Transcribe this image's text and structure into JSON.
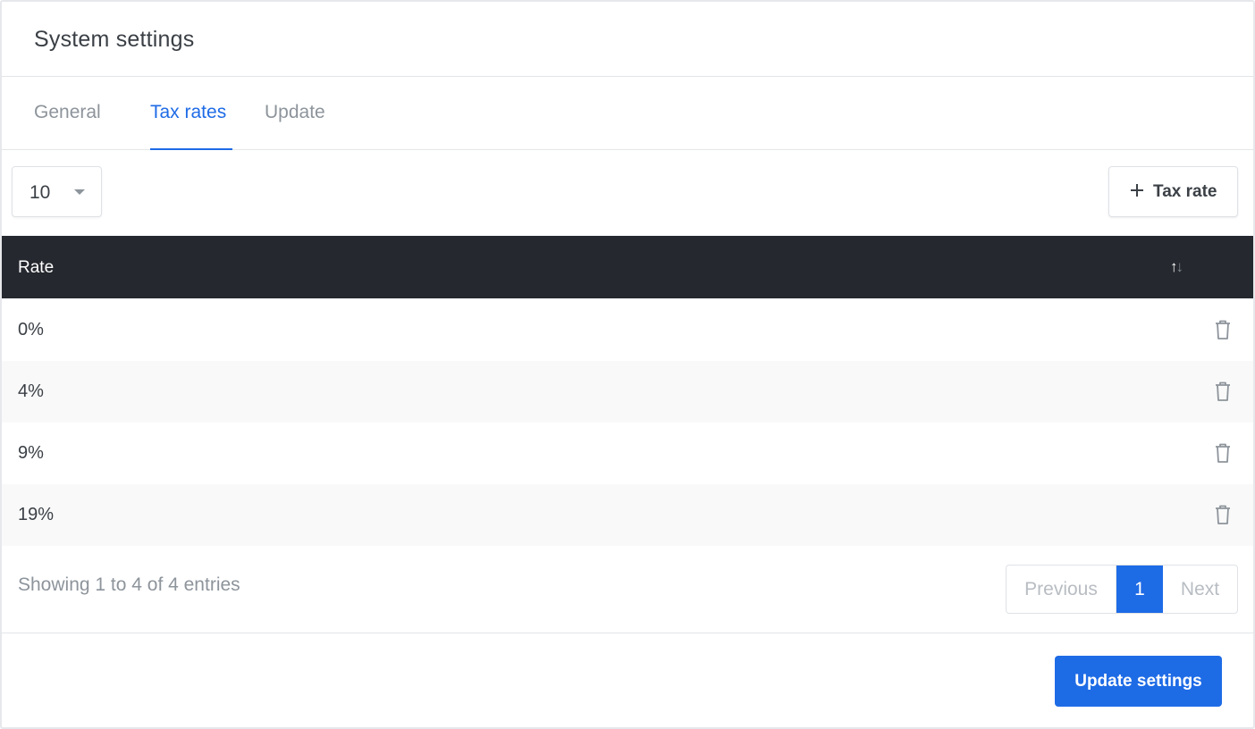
{
  "card": {
    "title": "System settings"
  },
  "tabs": [
    {
      "label": "General",
      "active": false
    },
    {
      "label": "Tax rates",
      "active": true
    },
    {
      "label": "Update",
      "active": false
    }
  ],
  "toolbar": {
    "page_length": "10",
    "add_button_label": "Tax rate"
  },
  "table": {
    "columns": [
      "Rate"
    ],
    "sort_icon": "sort-both-icon",
    "rows": [
      {
        "rate": "0%"
      },
      {
        "rate": "4%"
      },
      {
        "rate": "9%"
      },
      {
        "rate": "19%"
      }
    ],
    "row_action_icon": "trash-icon"
  },
  "pagination": {
    "info": "Showing 1 to 4 of 4 entries",
    "previous_label": "Previous",
    "current_page": "1",
    "next_label": "Next"
  },
  "footer": {
    "submit_label": "Update settings"
  },
  "colors": {
    "accent": "#1e6be6",
    "table_header_bg": "#25282e",
    "muted_text": "#8d949b"
  }
}
